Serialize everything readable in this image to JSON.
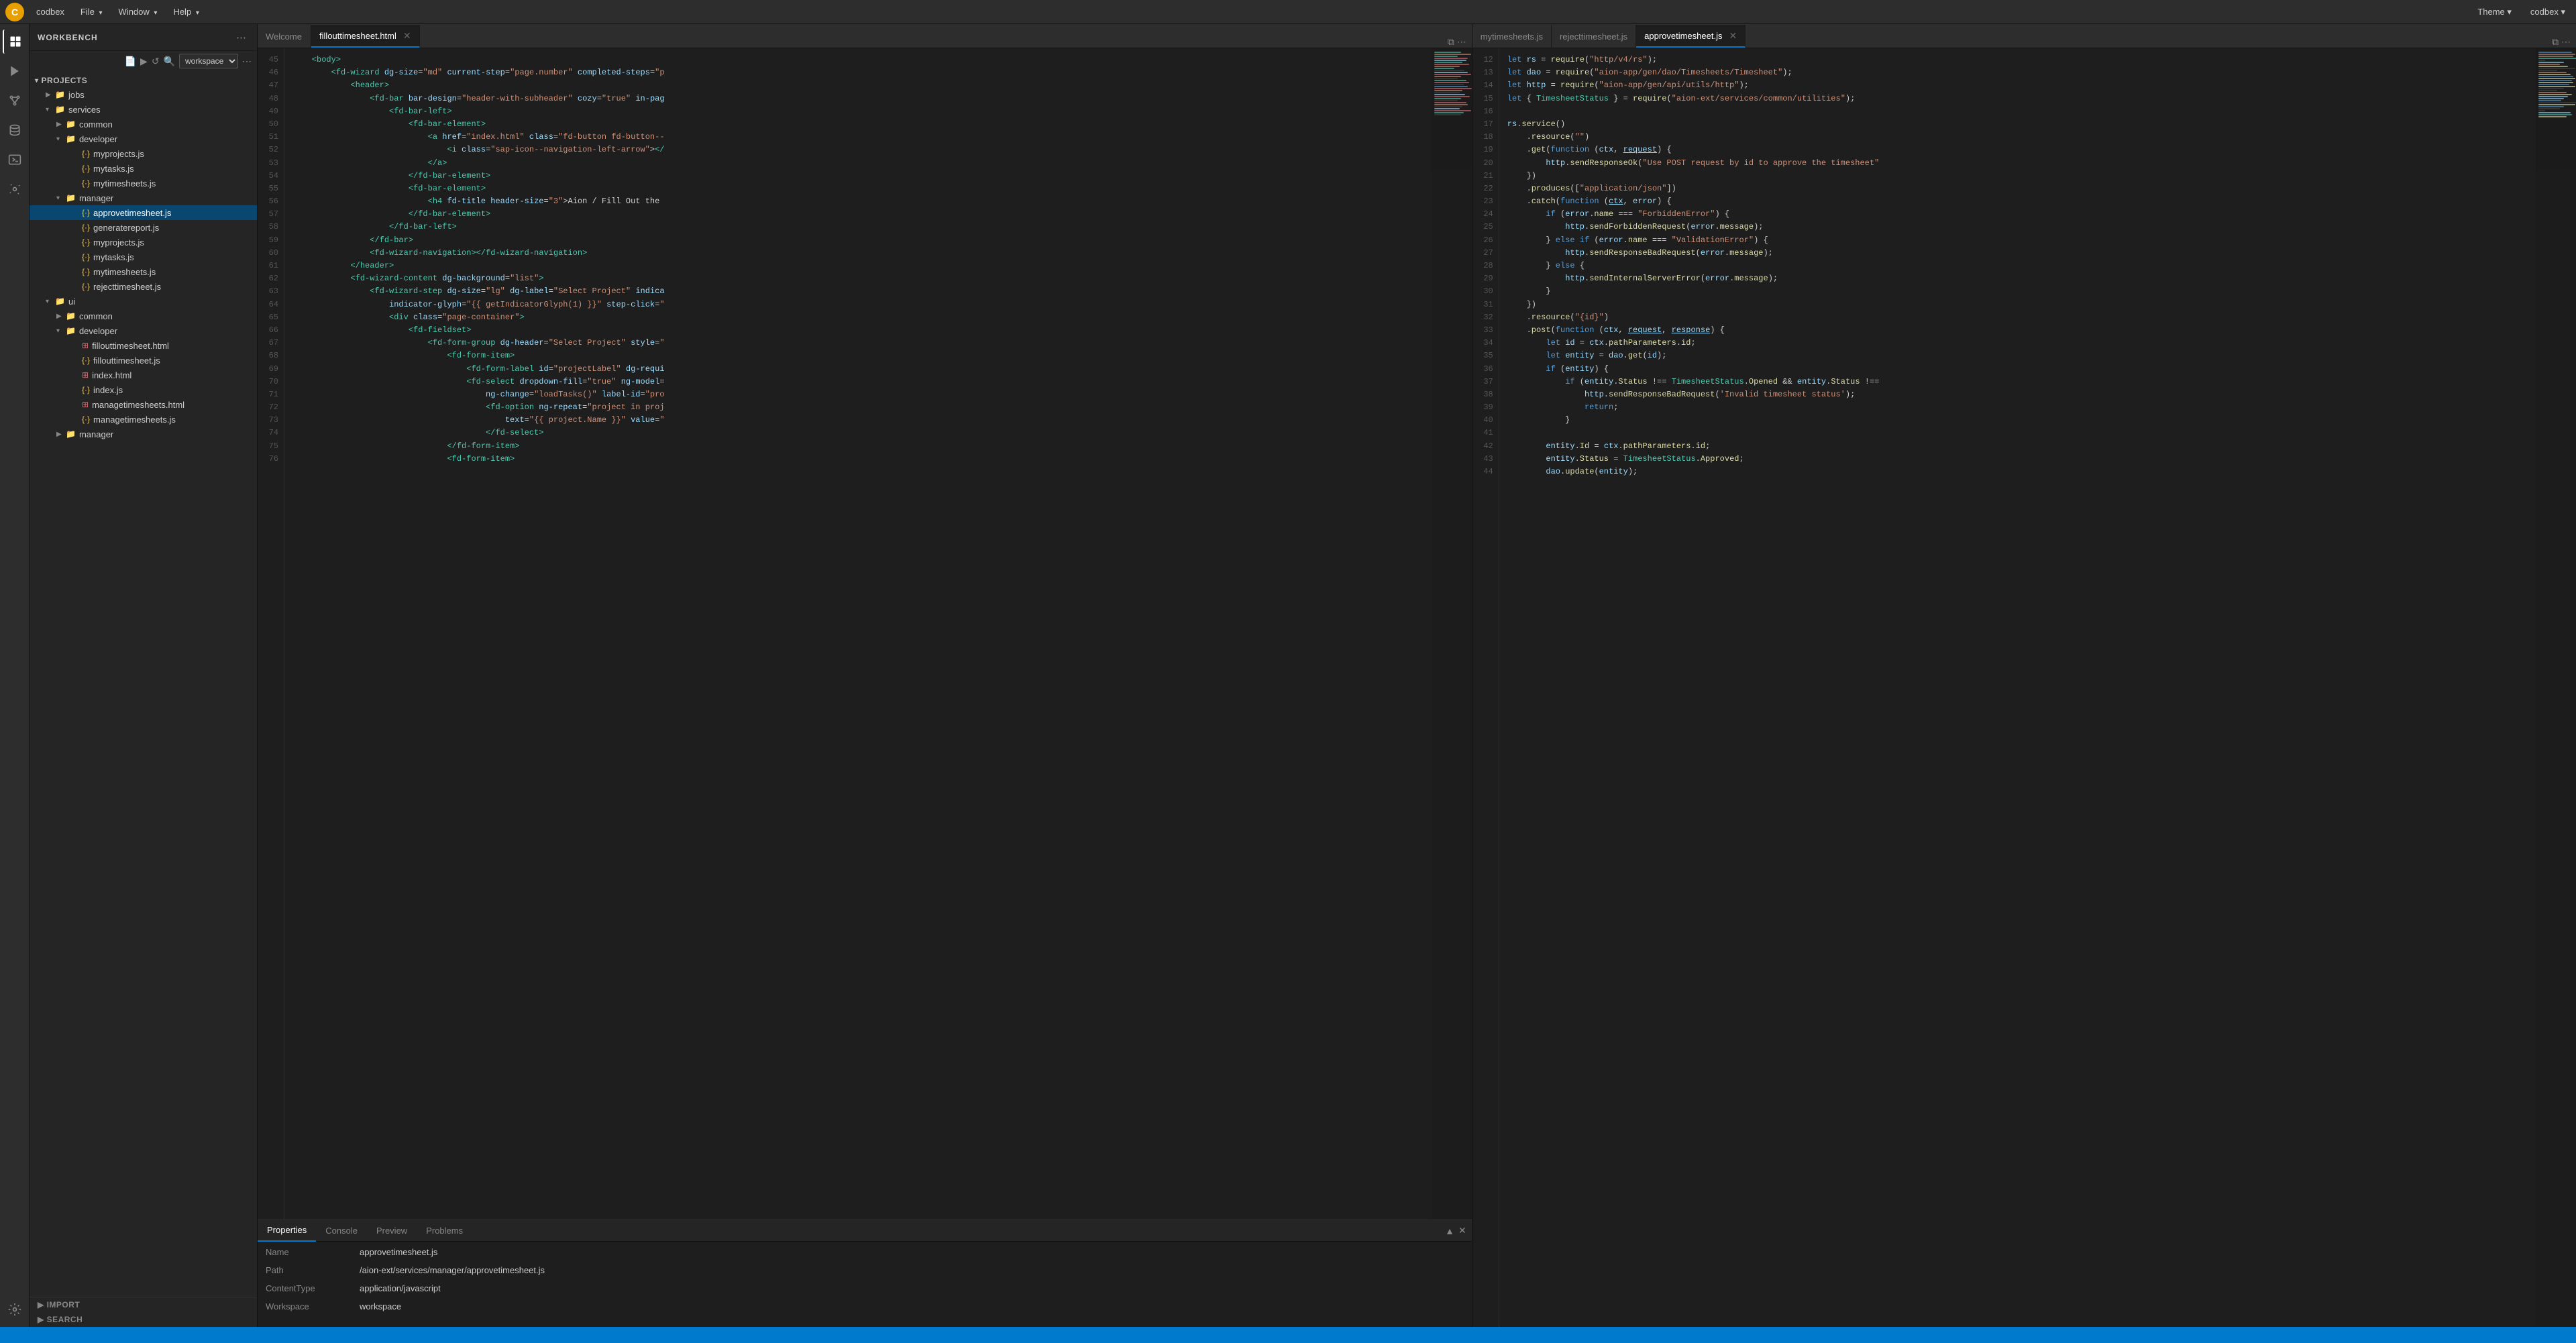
{
  "app": {
    "logo": "C",
    "name": "codbex"
  },
  "menubar": {
    "items": [
      {
        "label": "codbex"
      },
      {
        "label": "File",
        "hasArrow": true
      },
      {
        "label": "Window",
        "hasArrow": true
      },
      {
        "label": "Help",
        "hasArrow": true
      }
    ],
    "right": [
      {
        "label": "Theme",
        "hasArrow": true
      },
      {
        "label": "codbex",
        "hasArrow": true
      }
    ]
  },
  "sidebar": {
    "title": "Workbench",
    "projects_label": "PROJECTS",
    "footer": {
      "import": "IMPORT",
      "search": "SEARCH"
    }
  },
  "tree": {
    "items": [
      {
        "level": 1,
        "type": "folder",
        "name": "jobs",
        "open": true
      },
      {
        "level": 1,
        "type": "folder",
        "name": "services",
        "open": true
      },
      {
        "level": 2,
        "type": "folder",
        "name": "common",
        "open": false
      },
      {
        "level": 2,
        "type": "folder",
        "name": "developer",
        "open": true
      },
      {
        "level": 3,
        "type": "js",
        "name": "myprojects.js"
      },
      {
        "level": 3,
        "type": "js",
        "name": "mytasks.js"
      },
      {
        "level": 3,
        "type": "js",
        "name": "mytimesheets.js"
      },
      {
        "level": 2,
        "type": "folder",
        "name": "manager",
        "open": true
      },
      {
        "level": 3,
        "type": "js",
        "name": "approvetimesheet.js",
        "active": true
      },
      {
        "level": 3,
        "type": "js",
        "name": "generatereport.js"
      },
      {
        "level": 3,
        "type": "js",
        "name": "myprojects.js"
      },
      {
        "level": 3,
        "type": "js",
        "name": "mytasks.js"
      },
      {
        "level": 3,
        "type": "js",
        "name": "mytimesheets.js"
      },
      {
        "level": 3,
        "type": "js",
        "name": "rejecttimesheet.js"
      },
      {
        "level": 1,
        "type": "folder",
        "name": "ui",
        "open": true
      },
      {
        "level": 2,
        "type": "folder",
        "name": "common",
        "open": false
      },
      {
        "level": 2,
        "type": "folder",
        "name": "developer",
        "open": true
      },
      {
        "level": 3,
        "type": "html",
        "name": "fillouttimesheet.html"
      },
      {
        "level": 3,
        "type": "js",
        "name": "fillouttimesheet.js"
      },
      {
        "level": 3,
        "type": "html",
        "name": "index.html"
      },
      {
        "level": 3,
        "type": "js",
        "name": "index.js"
      },
      {
        "level": 3,
        "type": "html",
        "name": "managetimesheets.html"
      },
      {
        "level": 3,
        "type": "js",
        "name": "managetimesheets.js"
      },
      {
        "level": 2,
        "type": "folder",
        "name": "manager",
        "open": false
      }
    ]
  },
  "left_editor": {
    "tabs": [
      {
        "label": "Welcome",
        "active": false,
        "closeable": false
      },
      {
        "label": "fillouttimesheet.html",
        "active": true,
        "closeable": true
      }
    ],
    "lines": [
      45,
      46,
      47,
      48,
      49,
      50,
      51,
      52,
      53,
      54,
      55,
      56,
      57,
      58,
      59,
      60,
      61,
      62,
      63,
      64,
      65,
      66,
      67,
      68,
      69,
      70,
      71,
      72,
      73,
      74,
      75,
      76
    ],
    "code": [
      {
        "n": 45,
        "t": "    <body>"
      },
      {
        "n": 46,
        "t": "        <fd-wizard dg-size=\"md\" current-step=\"page.number\" completed-steps=\"p"
      },
      {
        "n": 47,
        "t": "            <header>"
      },
      {
        "n": 48,
        "t": "                <fd-bar bar-design=\"header-with-subheader\" cozy=\"true\" in-pag"
      },
      {
        "n": 49,
        "t": "                    <fd-bar-left>"
      },
      {
        "n": 50,
        "t": "                        <fd-bar-element>"
      },
      {
        "n": 51,
        "t": "                            <a href=\"index.html\" class=\"fd-button fd-button--"
      },
      {
        "n": 52,
        "t": "                                <i class=\"sap-icon--navigation-left-arrow\"></"
      },
      {
        "n": 53,
        "t": "                            </a>"
      },
      {
        "n": 54,
        "t": "                        </fd-bar-element>"
      },
      {
        "n": 55,
        "t": "                        <fd-bar-element>"
      },
      {
        "n": 56,
        "t": "                            <h4 fd-title header-size=\"3\">Aion / Fill Out the"
      },
      {
        "n": 57,
        "t": "                        </fd-bar-element>"
      },
      {
        "n": 58,
        "t": "                    </fd-bar-left>"
      },
      {
        "n": 59,
        "t": "                </fd-bar>"
      },
      {
        "n": 60,
        "t": "                <fd-wizard-navigation></fd-wizard-navigation>"
      },
      {
        "n": 61,
        "t": "            </header>"
      },
      {
        "n": 62,
        "t": "            <fd-wizard-content dg-background=\"list\">"
      },
      {
        "n": 63,
        "t": "                <fd-wizard-step dg-size=\"lg\" dg-label=\"Select Project\" indica"
      },
      {
        "n": 64,
        "t": "                    indicator-glyph=\"{{ getIndicatorGlyph(1) }}\" step-click=\""
      },
      {
        "n": 65,
        "t": "                    <div class=\"page-container\">"
      },
      {
        "n": 66,
        "t": "                        <fd-fieldset>"
      },
      {
        "n": 67,
        "t": "                            <fd-form-group dg-header=\"Select Project\" style=\""
      },
      {
        "n": 68,
        "t": "                                <fd-form-item>"
      },
      {
        "n": 69,
        "t": "                                    <fd-form-label id=\"projectLabel\" dg-requi"
      },
      {
        "n": 70,
        "t": "                                    <fd-select dropdown-fill=\"true\" ng-model="
      },
      {
        "n": 71,
        "t": "                                        ng-change=\"loadTasks()\" label-id=\"pro"
      },
      {
        "n": 72,
        "t": "                                        <fd-option ng-repeat=\"project in proj"
      },
      {
        "n": 73,
        "t": "                                            text=\"{{ project.Name }}\" value=\""
      },
      {
        "n": 74,
        "t": "                                        </fd-select>"
      },
      {
        "n": 75,
        "t": "                                </fd-form-item>"
      },
      {
        "n": 76,
        "t": "                                <fd-form-item>"
      }
    ]
  },
  "right_editor": {
    "tabs": [
      {
        "label": "mytimesheets.js",
        "active": false,
        "closeable": false
      },
      {
        "label": "rejecttimesheet.js",
        "active": false,
        "closeable": false
      },
      {
        "label": "approvetimesheet.js",
        "active": true,
        "closeable": true
      }
    ],
    "lines": [
      12,
      13,
      14,
      15,
      16,
      17,
      18,
      19,
      20,
      21,
      22,
      23,
      24,
      25,
      26,
      27,
      28,
      29,
      30,
      31,
      32,
      33,
      34,
      35,
      36,
      37,
      38,
      39,
      40,
      41,
      42,
      43,
      44
    ],
    "code": [
      {
        "n": 12,
        "t": "let rs = require(\"http/v4/rs\");"
      },
      {
        "n": 13,
        "t": "let dao = require(\"aion-app/gen/dao/Timesheets/Timesheet\");"
      },
      {
        "n": 14,
        "t": "let http = require(\"aion-app/gen/api/utils/http\");"
      },
      {
        "n": 15,
        "t": "let { TimesheetStatus } = require(\"aion-ext/services/common/utilities\");"
      },
      {
        "n": 16,
        "t": ""
      },
      {
        "n": 17,
        "t": "rs.service()"
      },
      {
        "n": 18,
        "t": "    .resource(\"\")"
      },
      {
        "n": 19,
        "t": "    .get(function (ctx, request) {"
      },
      {
        "n": 20,
        "t": "        http.sendResponseOk(\"Use POST request by id to approve the timesheet\""
      },
      {
        "n": 21,
        "t": "    })"
      },
      {
        "n": 22,
        "t": "    .produces([\"application/json\"])"
      },
      {
        "n": 23,
        "t": "    .catch(function (ctx, error) {"
      },
      {
        "n": 24,
        "t": "        if (error.name === \"ForbiddenError\") {"
      },
      {
        "n": 25,
        "t": "            http.sendForbiddenRequest(error.message);"
      },
      {
        "n": 26,
        "t": "        } else if (error.name === \"ValidationError\") {"
      },
      {
        "n": 27,
        "t": "            http.sendResponseBadRequest(error.message);"
      },
      {
        "n": 28,
        "t": "        } else {"
      },
      {
        "n": 29,
        "t": "            http.sendInternalServerError(error.message);"
      },
      {
        "n": 30,
        "t": "        }"
      },
      {
        "n": 31,
        "t": "    })"
      },
      {
        "n": 32,
        "t": "    .resource(\"{id}\")"
      },
      {
        "n": 33,
        "t": "    .post(function (ctx, request, response) {"
      },
      {
        "n": 34,
        "t": "        let id = ctx.pathParameters.id;"
      },
      {
        "n": 35,
        "t": "        let entity = dao.get(id);"
      },
      {
        "n": 36,
        "t": "        if (entity) {"
      },
      {
        "n": 37,
        "t": "            if (entity.Status !== TimesheetStatus.Opened && entity.Status !=="
      },
      {
        "n": 38,
        "t": "                http.sendResponseBadRequest('Invalid timesheet status');"
      },
      {
        "n": 39,
        "t": "                return;"
      },
      {
        "n": 40,
        "t": "            }"
      },
      {
        "n": 41,
        "t": ""
      },
      {
        "n": 42,
        "t": "        entity.Id = ctx.pathParameters.id;"
      },
      {
        "n": 43,
        "t": "        entity.Status = TimesheetStatus.Approved;"
      },
      {
        "n": 44,
        "t": "        dao.update(entity);"
      }
    ]
  },
  "panel": {
    "tabs": [
      "Properties",
      "Console",
      "Preview",
      "Problems"
    ],
    "active_tab": "Properties",
    "properties": {
      "name_label": "Name",
      "name_value": "approvetimesheet.js",
      "path_label": "Path",
      "path_value": "/aion-ext/services/manager/approvetimesheet.js",
      "contenttype_label": "ContentType",
      "contenttype_value": "application/javascript",
      "workspace_label": "Workspace",
      "workspace_value": "workspace"
    }
  },
  "workspace_selector": "workspace"
}
